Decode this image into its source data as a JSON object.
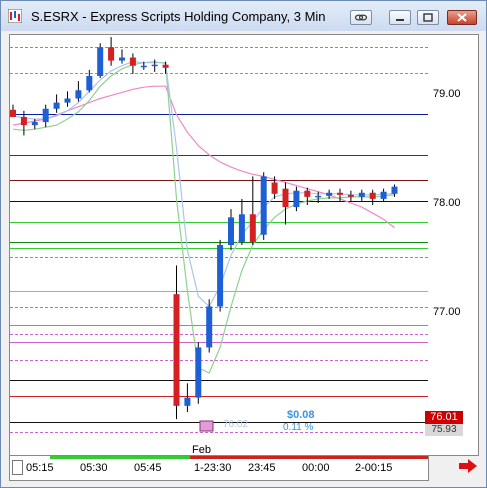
{
  "window": {
    "title": "S.ESRX - Express Scripts Holding Company, 3 Min"
  },
  "price_axis": {
    "labels": [
      "79.00",
      "78.00",
      "77.00"
    ],
    "last_price": "76.01",
    "last_price_color": "#ffffff",
    "last_price_bg": "#cc0000",
    "bid_tag": "75.93"
  },
  "time_axis": {
    "labels": [
      "05:15",
      "05:30",
      "05:45",
      "1-23:30",
      "23:45",
      "00:00",
      "2-00:15"
    ]
  },
  "overlay": {
    "pl_value": "$0.08",
    "pl_percent": "0.11 %",
    "faded_price": "76.02",
    "session_marker": "Feb"
  },
  "chart_data": {
    "type": "candlestick",
    "ylim": [
      75.4,
      79.5
    ],
    "candles": [
      {
        "o": 78.77,
        "c": 78.7,
        "h": 78.82,
        "l": 78.7
      },
      {
        "o": 78.7,
        "c": 78.62,
        "h": 78.76,
        "l": 78.52
      },
      {
        "o": 78.62,
        "c": 78.65,
        "h": 78.68,
        "l": 78.58
      },
      {
        "o": 78.65,
        "c": 78.78,
        "h": 78.82,
        "l": 78.6
      },
      {
        "o": 78.78,
        "c": 78.84,
        "h": 78.92,
        "l": 78.74
      },
      {
        "o": 78.84,
        "c": 78.88,
        "h": 78.95,
        "l": 78.8
      },
      {
        "o": 78.88,
        "c": 78.96,
        "h": 79.05,
        "l": 78.85
      },
      {
        "o": 78.96,
        "c": 79.1,
        "h": 79.16,
        "l": 78.94
      },
      {
        "o": 79.1,
        "c": 79.38,
        "h": 79.42,
        "l": 79.08
      },
      {
        "o": 79.38,
        "c": 79.25,
        "h": 79.48,
        "l": 79.2
      },
      {
        "o": 79.25,
        "c": 79.28,
        "h": 79.36,
        "l": 79.22
      },
      {
        "o": 79.28,
        "c": 79.2,
        "h": 79.32,
        "l": 79.12
      },
      {
        "o": 79.2,
        "c": 79.2,
        "h": 79.24,
        "l": 79.16
      },
      {
        "o": 79.2,
        "c": 79.21,
        "h": 79.26,
        "l": 79.14
      },
      {
        "o": 79.21,
        "c": 79.18,
        "h": 79.24,
        "l": 79.12
      },
      {
        "o": 76.97,
        "c": 75.88,
        "h": 77.25,
        "l": 75.75
      },
      {
        "o": 75.88,
        "c": 75.96,
        "h": 76.1,
        "l": 75.82
      },
      {
        "o": 75.96,
        "c": 76.45,
        "h": 76.5,
        "l": 75.9
      },
      {
        "o": 76.45,
        "c": 76.85,
        "h": 76.92,
        "l": 76.4
      },
      {
        "o": 76.85,
        "c": 77.45,
        "h": 77.5,
        "l": 76.8
      },
      {
        "o": 77.45,
        "c": 77.72,
        "h": 77.8,
        "l": 77.4
      },
      {
        "o": 77.48,
        "c": 77.75,
        "h": 77.9,
        "l": 77.45
      },
      {
        "o": 77.75,
        "c": 77.48,
        "h": 78.12,
        "l": 77.45
      },
      {
        "o": 77.55,
        "c": 78.12,
        "h": 78.16,
        "l": 77.5
      },
      {
        "o": 78.06,
        "c": 77.95,
        "h": 78.12,
        "l": 77.9
      },
      {
        "o": 78.0,
        "c": 77.82,
        "h": 78.06,
        "l": 77.65
      },
      {
        "o": 77.82,
        "c": 77.98,
        "h": 78.02,
        "l": 77.78
      },
      {
        "o": 77.98,
        "c": 77.92,
        "h": 78.01,
        "l": 77.84
      },
      {
        "o": 77.92,
        "c": 77.93,
        "h": 77.97,
        "l": 77.86
      },
      {
        "o": 77.93,
        "c": 77.96,
        "h": 77.99,
        "l": 77.9
      },
      {
        "o": 77.96,
        "c": 77.94,
        "h": 78.0,
        "l": 77.88
      },
      {
        "o": 77.94,
        "c": 77.92,
        "h": 77.98,
        "l": 77.88
      },
      {
        "o": 77.92,
        "c": 77.96,
        "h": 77.99,
        "l": 77.88
      },
      {
        "o": 77.96,
        "c": 77.9,
        "h": 77.99,
        "l": 77.84
      },
      {
        "o": 77.9,
        "c": 77.97,
        "h": 78.0,
        "l": 77.88
      },
      {
        "o": 77.95,
        "c": 78.02,
        "h": 78.04,
        "l": 77.92
      }
    ],
    "bull_color": "#1f5fd6",
    "bear_color": "#d42020",
    "horizontal_levels": [
      {
        "y": 79.38,
        "color": "#33cc33",
        "dash": true
      },
      {
        "y": 79.13,
        "color": "#cc66cc",
        "dash": true
      },
      {
        "y": 78.73,
        "color": "#0a1e9e",
        "dash": false
      },
      {
        "y": 78.33,
        "color": "#6a1a6a",
        "dash": false
      },
      {
        "y": 78.08,
        "color": "#7a1515",
        "dash": false
      },
      {
        "y": 77.88,
        "color": "#111111",
        "dash": false
      },
      {
        "y": 77.67,
        "color": "#33cc33",
        "dash": false
      },
      {
        "y": 77.48,
        "color": "#118a11",
        "dash": false
      },
      {
        "y": 77.42,
        "color": "#33cc33",
        "dash": false
      },
      {
        "y": 77.33,
        "color": "#33cc33",
        "dash": true
      },
      {
        "y": 77.0,
        "color": "#aaaaaa",
        "dash": false
      },
      {
        "y": 76.84,
        "color": "#cc66cc",
        "dash": true
      },
      {
        "y": 76.67,
        "color": "#cc66cc",
        "dash": false
      },
      {
        "y": 76.58,
        "color": "#cc66cc",
        "dash": true
      },
      {
        "y": 76.5,
        "color": "#cc66cc",
        "dash": false
      },
      {
        "y": 76.33,
        "color": "#cc66cc",
        "dash": true
      },
      {
        "y": 76.13,
        "color": "#111111",
        "dash": false
      },
      {
        "y": 75.98,
        "color": "#cc2222",
        "dash": false
      },
      {
        "y": 75.72,
        "color": "#111111",
        "dash": false
      },
      {
        "y": 75.62,
        "color": "#cc66cc",
        "dash": true
      }
    ],
    "dark_line": {
      "color": "#0a1e9e",
      "values": [
        78.73,
        78.73,
        78.73,
        78.73,
        78.73,
        78.73,
        78.73,
        78.73,
        78.73,
        78.73,
        78.73,
        78.73,
        78.73,
        78.73,
        78.72,
        78.73,
        78.73,
        78.73,
        78.73,
        78.73,
        78.73,
        78.73,
        78.73,
        78.73,
        78.73,
        78.73,
        78.73,
        78.73,
        78.73,
        78.73,
        78.73,
        78.73,
        78.73,
        78.73,
        78.73,
        78.73
      ]
    },
    "pink_ma": {
      "color": "#ee88cc",
      "values": [
        78.62,
        78.64,
        78.66,
        78.68,
        78.72,
        78.76,
        78.8,
        78.84,
        78.88,
        78.91,
        78.94,
        78.97,
        78.99,
        79.0,
        79.0,
        78.72,
        78.55,
        78.42,
        78.33,
        78.26,
        78.21,
        78.17,
        78.14,
        78.12,
        78.09,
        78.06,
        78.03,
        78.0,
        77.97,
        77.94,
        77.9,
        77.86,
        77.82,
        77.76,
        77.7,
        77.62
      ]
    },
    "blue_ma": {
      "color": "#aac6ea",
      "values": [
        78.71,
        78.69,
        78.68,
        78.68,
        78.71,
        78.76,
        78.84,
        78.95,
        79.06,
        79.15,
        79.2,
        79.24,
        79.23,
        79.24,
        79.22,
        78.4,
        77.4,
        76.95,
        76.85,
        77.05,
        77.35,
        77.55,
        77.68,
        77.82,
        77.92,
        77.95,
        77.96,
        77.96,
        77.95,
        77.95,
        77.95,
        77.94,
        77.94,
        77.94,
        77.95,
        77.95
      ]
    },
    "green_ma": {
      "color": "#8fd18f",
      "values": [
        78.58,
        78.57,
        78.58,
        78.6,
        78.62,
        78.68,
        78.75,
        78.86,
        79.0,
        79.1,
        79.17,
        79.21,
        79.23,
        79.23,
        79.23,
        77.9,
        77.0,
        76.25,
        76.2,
        76.45,
        76.85,
        77.2,
        77.45,
        77.6,
        77.72,
        77.8,
        77.85,
        77.88,
        77.9,
        77.91,
        77.91,
        77.92,
        77.92,
        77.92,
        77.93,
        77.94
      ]
    }
  }
}
